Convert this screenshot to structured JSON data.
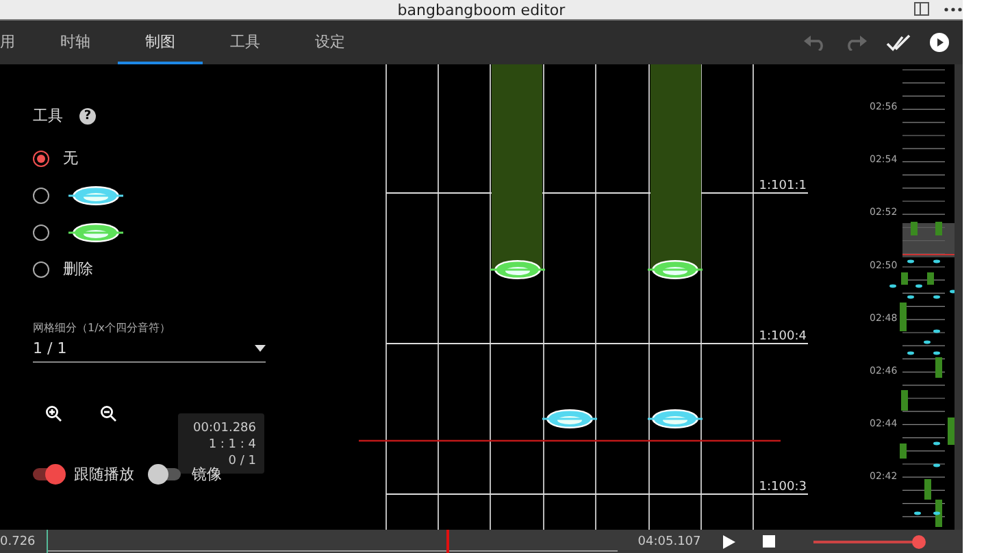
{
  "window": {
    "title": "bangbangboom editor"
  },
  "tabs": [
    {
      "label": "用",
      "selected": false
    },
    {
      "label": "时轴",
      "selected": false
    },
    {
      "label": "制图",
      "selected": true
    },
    {
      "label": "工具",
      "selected": false
    },
    {
      "label": "设定",
      "selected": false
    }
  ],
  "tools": {
    "title": "工具",
    "help": "?",
    "options": [
      {
        "kind": "text",
        "label": "无",
        "selected": true
      },
      {
        "kind": "note",
        "color": "#55d8f0",
        "selected": false
      },
      {
        "kind": "note",
        "color": "#5ee05a",
        "selected": false
      },
      {
        "kind": "text",
        "label": "删除",
        "selected": false
      }
    ]
  },
  "grid_division": {
    "label": "网格细分（1/x个四分音符）",
    "value": "1 / 1"
  },
  "toggles": [
    {
      "label": "跟随播放",
      "on": true
    },
    {
      "label": "镜像",
      "on": false
    }
  ],
  "cursor_info": [
    "00:01.286",
    "1 : 1 : 4",
    "0 / 1"
  ],
  "measures": [
    {
      "label": "1:101:1"
    },
    {
      "label": "1:100:4"
    },
    {
      "label": "1:100:3"
    }
  ],
  "minimap": {
    "times": [
      "02:56",
      "02:54",
      "02:52",
      "02:50",
      "02:48",
      "02:46",
      "02:44",
      "02:42"
    ]
  },
  "bottom_bar": {
    "current_time": "0.726",
    "progress": {
      "level": 0.7
    },
    "total_time": "04:05.107",
    "volume": {
      "level": 0.96
    }
  }
}
